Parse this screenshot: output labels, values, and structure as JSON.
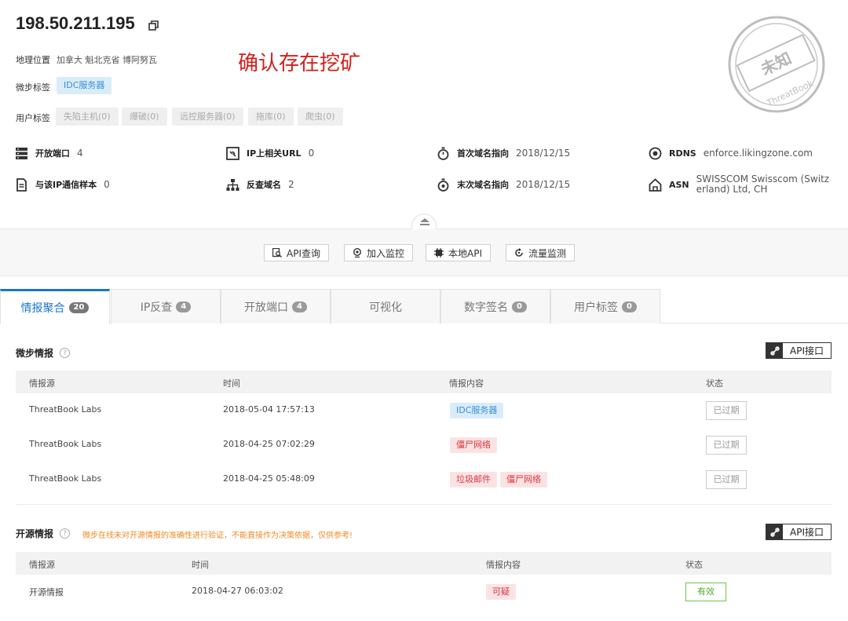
{
  "header": {
    "ip": "198.50.211.195",
    "geo_label": "地理位置",
    "geo_value": "加拿大 魁北克省 博阿努瓦",
    "annotation": "确认存在挖矿",
    "tb_tags_label": "微步标签",
    "tb_tag": "IDC服务器",
    "user_tags_label": "用户标签",
    "user_tags": [
      "失陷主机(0)",
      "爆破(0)",
      "远控服务器(0)",
      "拖库(0)",
      "爬虫(0)"
    ],
    "stamp_text": "未知",
    "stamp_sub": "ThreatBook"
  },
  "stats": {
    "open_ports_label": "开放端口",
    "open_ports_value": "4",
    "ip_url_label": "IP上相关URL",
    "ip_url_value": "0",
    "first_domain_label": "首次域名指向",
    "first_domain_value": "2018/12/15",
    "rdns_label": "RDNS",
    "rdns_value": "enforce.likingzone.com",
    "samples_label": "与该IP通信样本",
    "samples_value": "0",
    "reverse_label": "反查域名",
    "reverse_value": "2",
    "last_domain_label": "末次域名指向",
    "last_domain_value": "2018/12/15",
    "asn_label": "ASN",
    "asn_value_line1": "SWISSCOM Swisscom (Switz",
    "asn_value_line2": "erland) Ltd, CH"
  },
  "toolbar": {
    "api_query": "API查询",
    "add_monitor": "加入监控",
    "local_api": "本地API",
    "traffic_monitor": "流量监测"
  },
  "tabs": [
    {
      "label": "情报聚合",
      "count": "20"
    },
    {
      "label": "IP反查",
      "count": "4"
    },
    {
      "label": "开放端口",
      "count": "4"
    },
    {
      "label": "可视化",
      "count": ""
    },
    {
      "label": "数字签名",
      "count": "0"
    },
    {
      "label": "用户标签",
      "count": "0"
    }
  ],
  "tb_intel": {
    "title": "微步情报",
    "api_label": "API接口",
    "columns": [
      "情报源",
      "时间",
      "情报内容",
      "状态"
    ],
    "rows": [
      {
        "source": "ThreatBook Labs",
        "time": "2018-05-04 17:57:13",
        "tags": [
          "IDC服务器"
        ],
        "status": "已过期"
      },
      {
        "source": "ThreatBook Labs",
        "time": "2018-04-25 07:02:29",
        "tags": [
          "僵尸网络"
        ],
        "status": "已过期"
      },
      {
        "source": "ThreatBook Labs",
        "time": "2018-04-25 05:48:09",
        "tags": [
          "垃圾邮件",
          "僵尸网络"
        ],
        "status": "已过期"
      }
    ]
  },
  "os_intel": {
    "title": "开源情报",
    "warning": "微步在线未对开源情报的准确性进行验证，不能直接作为决策依据，仅供参考!",
    "api_label": "API接口",
    "columns": [
      "情报源",
      "时间",
      "情报内容",
      "状态"
    ],
    "rows": [
      {
        "source": "开源情报",
        "time": "2018-04-27 06:03:02",
        "tags": [
          "可疑"
        ],
        "status": "有效"
      }
    ]
  },
  "colors": {
    "accent": "#1976c9",
    "red_tag": "#d9363e",
    "blue_tag": "#3a8fd6",
    "valid": "#52a832",
    "warning": "#f08a24"
  }
}
